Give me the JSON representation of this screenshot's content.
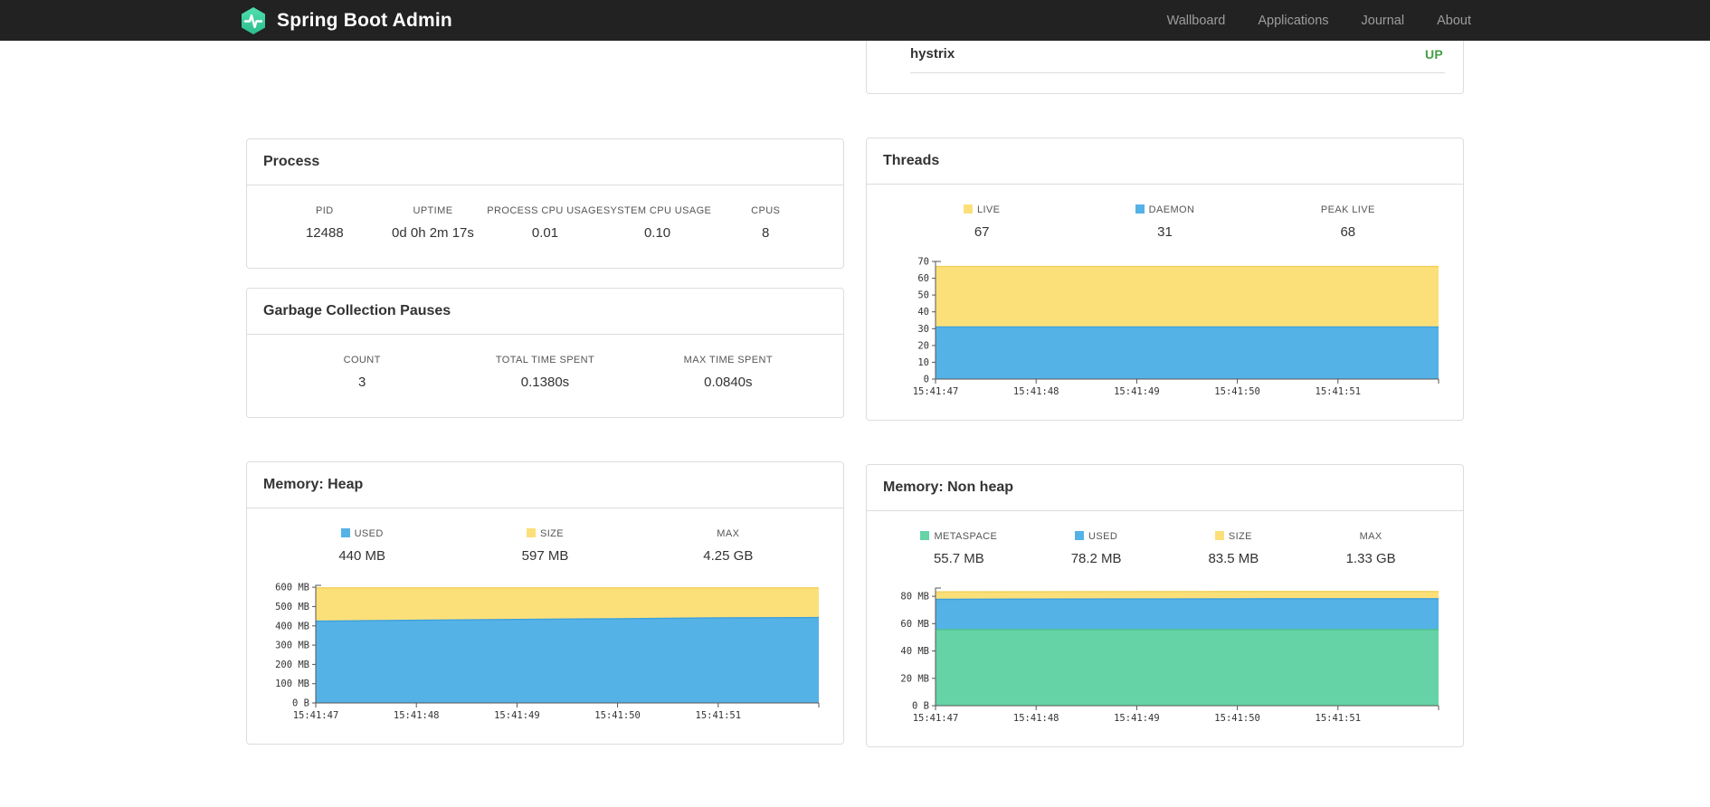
{
  "colors": {
    "navbar_bg": "#222222",
    "brand_green": "#3ecf9b",
    "status_up": "#43a047",
    "chart_yellow": "#fbe07a",
    "chart_blue": "#55b2e7",
    "chart_green": "#65d3a5"
  },
  "navbar": {
    "brand": "Spring Boot Admin",
    "links": [
      {
        "label": "Wallboard"
      },
      {
        "label": "Applications"
      },
      {
        "label": "Journal"
      },
      {
        "label": "About"
      }
    ]
  },
  "applications_panel": {
    "rows": [
      {
        "name": "hystrix",
        "status": "UP"
      }
    ]
  },
  "process_panel": {
    "title": "Process",
    "metrics": [
      {
        "label": "PID",
        "value": "12488"
      },
      {
        "label": "UPTIME",
        "value": "0d 0h 2m 17s"
      },
      {
        "label": "PROCESS CPU USAGE",
        "value": "0.01"
      },
      {
        "label": "SYSTEM CPU USAGE",
        "value": "0.10"
      },
      {
        "label": "CPUS",
        "value": "8"
      }
    ]
  },
  "gc_panel": {
    "title": "Garbage Collection Pauses",
    "metrics": [
      {
        "label": "COUNT",
        "value": "3"
      },
      {
        "label": "TOTAL TIME SPENT",
        "value": "0.1380s"
      },
      {
        "label": "MAX TIME SPENT",
        "value": "0.0840s"
      }
    ]
  },
  "threads_panel": {
    "title": "Threads",
    "legend": [
      {
        "label": "LIVE",
        "value": "67",
        "color": "#fbe07a"
      },
      {
        "label": "DAEMON",
        "value": "31",
        "color": "#55b2e7"
      },
      {
        "label": "PEAK LIVE",
        "value": "68",
        "color": null
      }
    ]
  },
  "memory_heap_panel": {
    "title": "Memory: Heap",
    "legend": [
      {
        "label": "USED",
        "value": "440 MB",
        "color": "#55b2e7"
      },
      {
        "label": "SIZE",
        "value": "597 MB",
        "color": "#fbe07a"
      },
      {
        "label": "MAX",
        "value": "4.25 GB",
        "color": null
      }
    ]
  },
  "memory_nonheap_panel": {
    "title": "Memory: Non heap",
    "legend": [
      {
        "label": "METASPACE",
        "value": "55.7 MB",
        "color": "#65d3a5"
      },
      {
        "label": "USED",
        "value": "78.2 MB",
        "color": "#55b2e7"
      },
      {
        "label": "SIZE",
        "value": "83.5 MB",
        "color": "#fbe07a"
      },
      {
        "label": "MAX",
        "value": "1.33 GB",
        "color": null
      }
    ]
  },
  "chart_data": [
    {
      "id": "threads-chart",
      "type": "area",
      "title": "Threads",
      "x_labels": [
        "15:41:47",
        "15:41:48",
        "15:41:49",
        "15:41:50",
        "15:41:51"
      ],
      "ylim": [
        0,
        70
      ],
      "yticks": [
        {
          "v": 0,
          "label": "0"
        },
        {
          "v": 10,
          "label": "10"
        },
        {
          "v": 20,
          "label": "20"
        },
        {
          "v": 30,
          "label": "30"
        },
        {
          "v": 40,
          "label": "40"
        },
        {
          "v": 50,
          "label": "50"
        },
        {
          "v": 60,
          "label": "60"
        },
        {
          "v": 70,
          "label": "70"
        }
      ],
      "series": [
        {
          "name": "LIVE",
          "color": "#fbe07a",
          "line": "#f2d055",
          "values": [
            67,
            67,
            67,
            67,
            67,
            67
          ]
        },
        {
          "name": "DAEMON",
          "color": "#55b2e7",
          "line": "#3da0dd",
          "values": [
            31,
            31,
            31,
            31,
            31,
            31
          ]
        }
      ]
    },
    {
      "id": "memory-heap-chart",
      "type": "area",
      "title": "Memory: Heap",
      "x_labels": [
        "15:41:47",
        "15:41:48",
        "15:41:49",
        "15:41:50",
        "15:41:51"
      ],
      "ylim": [
        0,
        610
      ],
      "yticks": [
        {
          "v": 0,
          "label": "0 B"
        },
        {
          "v": 100,
          "label": "100 MB"
        },
        {
          "v": 200,
          "label": "200 MB"
        },
        {
          "v": 300,
          "label": "300 MB"
        },
        {
          "v": 400,
          "label": "400 MB"
        },
        {
          "v": 500,
          "label": "500 MB"
        },
        {
          "v": 600,
          "label": "600 MB"
        }
      ],
      "series": [
        {
          "name": "SIZE",
          "color": "#fbe07a",
          "line": "#f2d055",
          "values": [
            597,
            597,
            597,
            597,
            597,
            597
          ]
        },
        {
          "name": "USED",
          "color": "#55b2e7",
          "line": "#3da0dd",
          "values": [
            424,
            429,
            433,
            437,
            441,
            443
          ]
        }
      ]
    },
    {
      "id": "memory-nonheap-chart",
      "type": "area",
      "title": "Memory: Non heap",
      "x_labels": [
        "15:41:47",
        "15:41:48",
        "15:41:49",
        "15:41:50",
        "15:41:51"
      ],
      "ylim": [
        0,
        86
      ],
      "yticks": [
        {
          "v": 0,
          "label": "0 B"
        },
        {
          "v": 20,
          "label": "20 MB"
        },
        {
          "v": 40,
          "label": "40 MB"
        },
        {
          "v": 60,
          "label": "60 MB"
        },
        {
          "v": 80,
          "label": "80 MB"
        }
      ],
      "series": [
        {
          "name": "SIZE",
          "color": "#fbe07a",
          "line": "#f2d055",
          "values": [
            83.2,
            83.3,
            83.4,
            83.5,
            83.5,
            83.5
          ]
        },
        {
          "name": "USED",
          "color": "#55b2e7",
          "line": "#3da0dd",
          "values": [
            77.7,
            77.9,
            78.0,
            78.1,
            78.2,
            78.2
          ]
        },
        {
          "name": "METASPACE",
          "color": "#65d3a5",
          "line": "#4cc28e",
          "values": [
            55.7,
            55.7,
            55.7,
            55.7,
            55.7,
            55.7
          ]
        }
      ]
    }
  ]
}
